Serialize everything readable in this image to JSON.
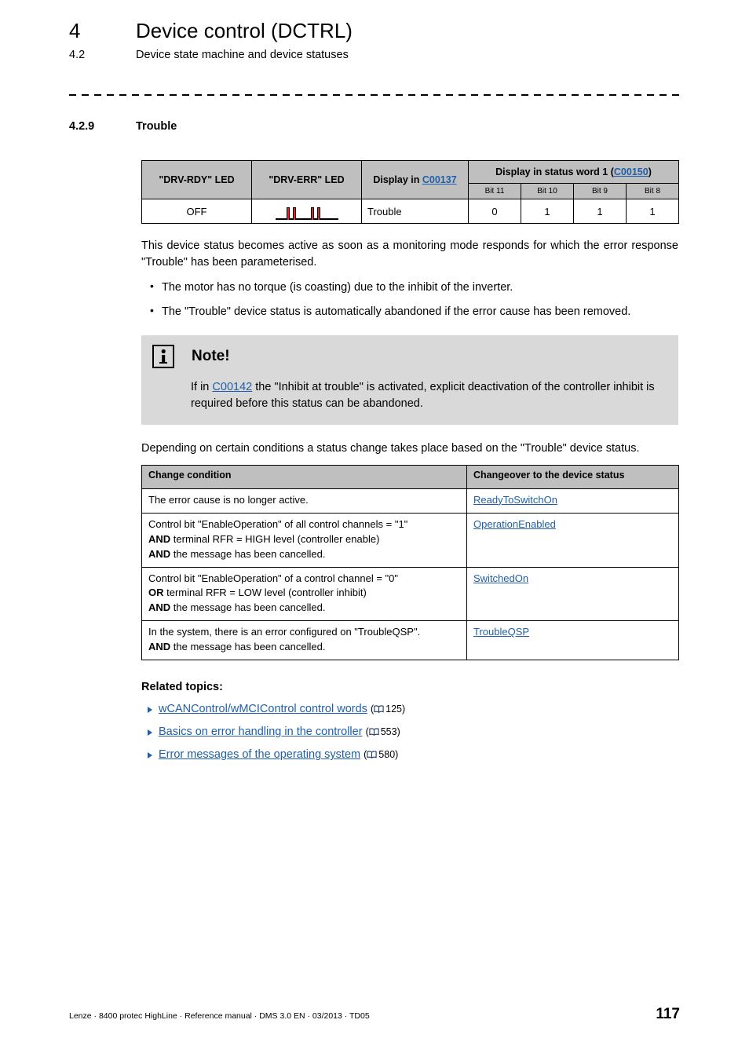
{
  "header": {
    "chapter_number": "4",
    "chapter_title": "Device control (DCTRL)",
    "section_number": "4.2",
    "section_title": "Device state machine and device statuses"
  },
  "section": {
    "number": "4.2.9",
    "title": "Trouble"
  },
  "status_table": {
    "headers": {
      "drv_rdy": "\"DRV-RDY\" LED",
      "drv_err": "\"DRV-ERR\" LED",
      "display_in_prefix": "Display in ",
      "display_in_link": "C00137",
      "status_word_prefix": "Display in status word 1 (",
      "status_word_link": "C00150",
      "status_word_suffix": ")"
    },
    "bit_headers": [
      "Bit 11",
      "Bit 10",
      "Bit 9",
      "Bit 8"
    ],
    "row": {
      "drv_rdy_value": "OFF",
      "drv_err_pattern": "double-flash-red",
      "display_value": "Trouble",
      "bit_values": [
        "0",
        "1",
        "1",
        "1"
      ]
    }
  },
  "intro": {
    "paragraph": "This device status becomes active as soon as a monitoring mode responds for which the error response \"Trouble\" has been parameterised.",
    "bullets": [
      "The motor has no torque (is coasting) due to the inhibit of the inverter.",
      "The \"Trouble\" device status is automatically abandoned if the error cause has been removed."
    ]
  },
  "note": {
    "title": "Note!",
    "text_before_link": "If in ",
    "link": "C00142",
    "text_after_link": " the \"Inhibit at trouble\" is activated, explicit deactivation of the controller inhibit is required before this status can be abandoned."
  },
  "change_section": {
    "lead": "Depending on certain conditions a status change takes place based on the \"Trouble\" device status.",
    "headers": [
      "Change condition",
      "Changeover to the device status"
    ],
    "rows": [
      {
        "condition_lines": [
          {
            "bold": "",
            "text": "The error cause is no longer active."
          }
        ],
        "status": "ReadyToSwitchOn"
      },
      {
        "condition_lines": [
          {
            "bold": "",
            "text": "Control bit \"EnableOperation\" of all control channels = \"1\""
          },
          {
            "bold": "AND",
            "text": " terminal RFR = HIGH level (controller enable)"
          },
          {
            "bold": "AND",
            "text": " the message has been cancelled."
          }
        ],
        "status": "OperationEnabled"
      },
      {
        "condition_lines": [
          {
            "bold": "",
            "text": "Control bit \"EnableOperation\" of a control channel = \"0\""
          },
          {
            "bold": "OR",
            "text": " terminal RFR = LOW level (controller inhibit)"
          },
          {
            "bold": "AND",
            "text": " the message has been cancelled."
          }
        ],
        "status": "SwitchedOn"
      },
      {
        "condition_lines": [
          {
            "bold": "",
            "text": "In the system, there is an error configured on \"TroubleQSP\"."
          },
          {
            "bold": "AND",
            "text": " the message has been cancelled."
          }
        ],
        "status": "TroubleQSP"
      }
    ]
  },
  "related": {
    "title": "Related topics:",
    "items": [
      {
        "label": "wCANControl/wMCIControl control words",
        "page": "125"
      },
      {
        "label": "Basics on error handling in the controller",
        "page": "553"
      },
      {
        "label": "Error messages of the operating system",
        "page": "580"
      }
    ]
  },
  "footer": {
    "text": "Lenze · 8400 protec HighLine · Reference manual · DMS 3.0 EN · 03/2013 · TD05",
    "page_number": "117"
  },
  "colors": {
    "link": "#1f5fa9",
    "table_header_gray": "#bfbfbf",
    "note_gray": "#d9d9d9",
    "led_red": "#d42a2a"
  }
}
